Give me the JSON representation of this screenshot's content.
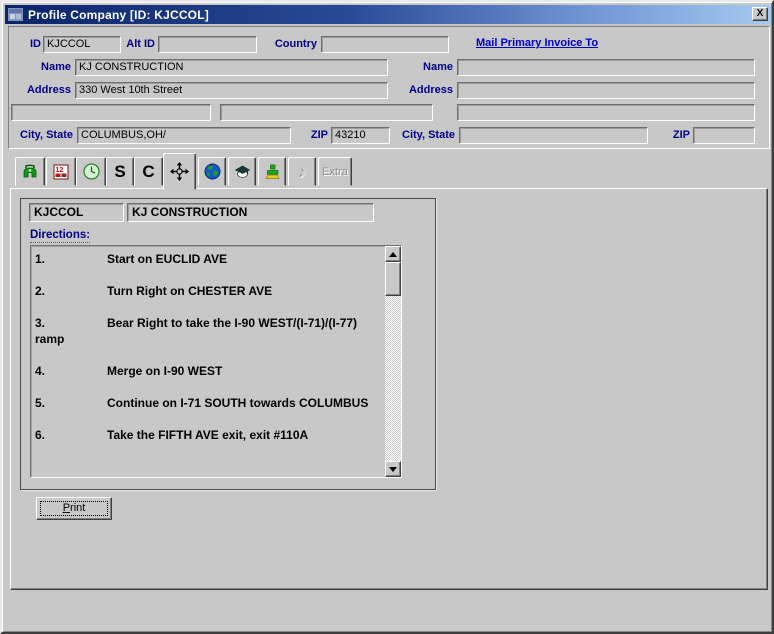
{
  "window": {
    "title": "Profile Company [ID: KJCCOL]",
    "close_glyph": "X"
  },
  "primary": {
    "id_label": "ID",
    "id_value": "KJCCOL",
    "alt_id_label": "Alt ID",
    "alt_id_value": "",
    "country_label": "Country",
    "country_value": "",
    "name_label": "Name",
    "name_value": "KJ CONSTRUCTION",
    "address_label": "Address",
    "address_value": "330 West 10th Street",
    "address_line2_value": "",
    "address_line3_value": "",
    "city_state_label": "City, State",
    "city_state_value": "COLUMBUS,OH/",
    "zip_label": "ZIP",
    "zip_value": "43210"
  },
  "invoice_to": {
    "link_label": "Mail Primary Invoice To",
    "name_label": "Name",
    "name_value": "",
    "address_label": "Address",
    "address_value": "",
    "address_line2_value": "",
    "city_state_label": "City, State",
    "city_state_value": "",
    "zip_label": "ZIP",
    "zip_value": ""
  },
  "tabs": [
    {
      "id": "phone",
      "icon": "telephone-icon"
    },
    {
      "id": "calendar",
      "icon": "calendar-icon"
    },
    {
      "id": "clock",
      "icon": "clock-icon"
    },
    {
      "id": "s",
      "glyph": "S"
    },
    {
      "id": "c",
      "glyph": "C"
    },
    {
      "id": "directions",
      "icon": "move-crosshair-icon",
      "active": true
    },
    {
      "id": "globe",
      "icon": "globe-icon"
    },
    {
      "id": "graduation",
      "icon": "graduation-cap-icon"
    },
    {
      "id": "network",
      "icon": "network-tree-icon"
    },
    {
      "id": "music",
      "glyph": "♪",
      "disabled": true
    },
    {
      "id": "extra",
      "label": "Extra",
      "disabled": true
    }
  ],
  "directions_tab": {
    "id_value": "KJCCOL",
    "name_value": "KJ CONSTRUCTION",
    "section_label": "Directions:",
    "steps": [
      {
        "num": "1.",
        "text": "Start on EUCLID AVE"
      },
      {
        "num": "2.",
        "text": "Turn Right on CHESTER AVE"
      },
      {
        "num": "3.",
        "text": "Bear Right to take the I-90 WEST/(I-71)/(I-77) ramp"
      },
      {
        "num": "4.",
        "text": "Merge on I-90 WEST"
      },
      {
        "num": "5.",
        "text": "Continue on I-71 SOUTH towards COLUMBUS"
      },
      {
        "num": "6.",
        "text": "Take the FIFTH AVE exit, exit #110A"
      }
    ],
    "print_label": "Print"
  },
  "colors": {
    "titlebar_start": "#0A246A",
    "titlebar_end": "#A6CAF0",
    "window_bg": "#C8C8C8",
    "label_navy": "#00008B",
    "link_blue": "#0000CC"
  }
}
